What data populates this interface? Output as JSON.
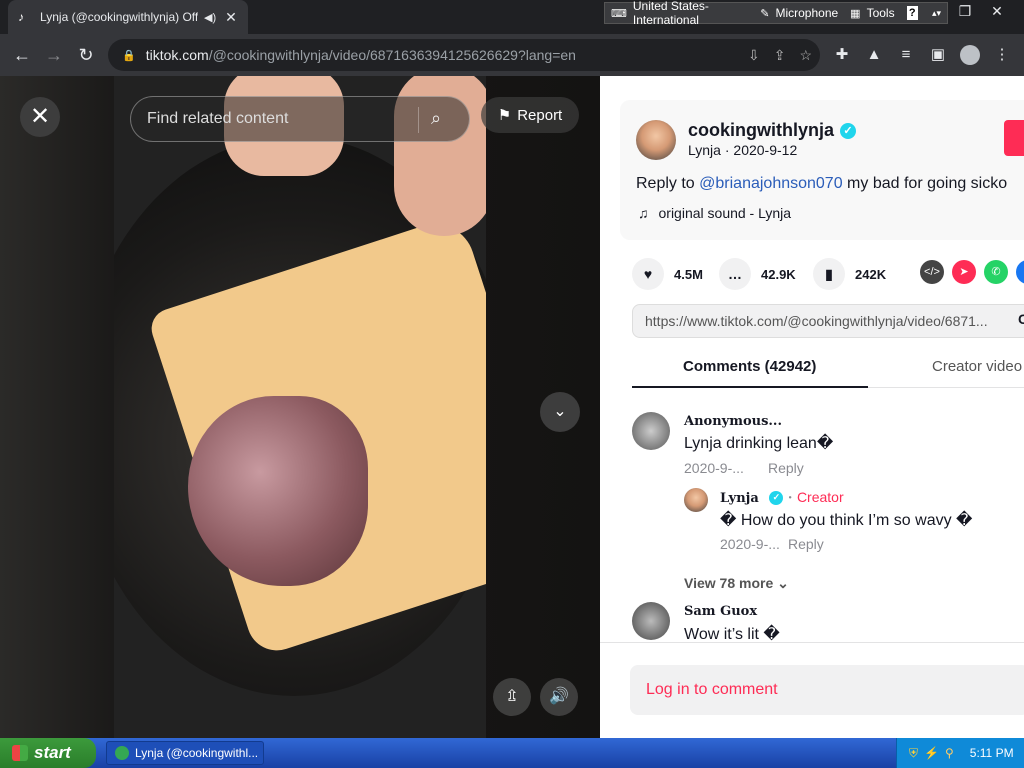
{
  "browser": {
    "tab_title": "Lynja (@cookingwithlynja) Offi",
    "tab_favicon": "tiktok-icon",
    "url_host": "tiktok.com",
    "url_path": "/@cookingwithlynja/video/6871636394125626629?lang=en",
    "language_bar": {
      "keyboard": "United States-International",
      "microphone": "Microphone",
      "tools": "Tools",
      "help": "?"
    }
  },
  "video": {
    "search_placeholder": "Find related content",
    "report_label": "Report"
  },
  "post": {
    "username": "cookingwithlynja",
    "display_name": "Lynja",
    "date": "2020-9-12",
    "description_prefix": "Reply to ",
    "description_mention": "@brianajohnson070",
    "description_rest": " my bad for going sicko",
    "sound": "original sound - Lynja",
    "likes": "4.5M",
    "comments": "42.9K",
    "saves": "242K",
    "share_link": "https://www.tiktok.com/@cookingwithlynja/video/6871...",
    "share_link_action": "C"
  },
  "tabs": {
    "comments": "Comments (42942)",
    "creator_videos": "Creator video"
  },
  "comments": [
    {
      "name": "Anonymous...",
      "text": "Lynja drinking lean�",
      "date": "2020-9-...",
      "reply": "Reply"
    },
    {
      "name": "Lynja",
      "badge": "Creator",
      "text": "� How do you think I’m so wavy �",
      "date": "2020-9-...",
      "reply": "Reply"
    },
    {
      "name": "Sam Guox",
      "text": "Wow it’s lit �"
    }
  ],
  "view_more": "View 78 more",
  "login_prompt": "Log in to comment",
  "taskbar": {
    "start": "start",
    "task": "Lynja (@cookingwithl...",
    "clock": "5:11 PM"
  },
  "colors": {
    "accent": "#fe2c55",
    "mention": "#2b5db9",
    "verified": "#20d5ec"
  }
}
